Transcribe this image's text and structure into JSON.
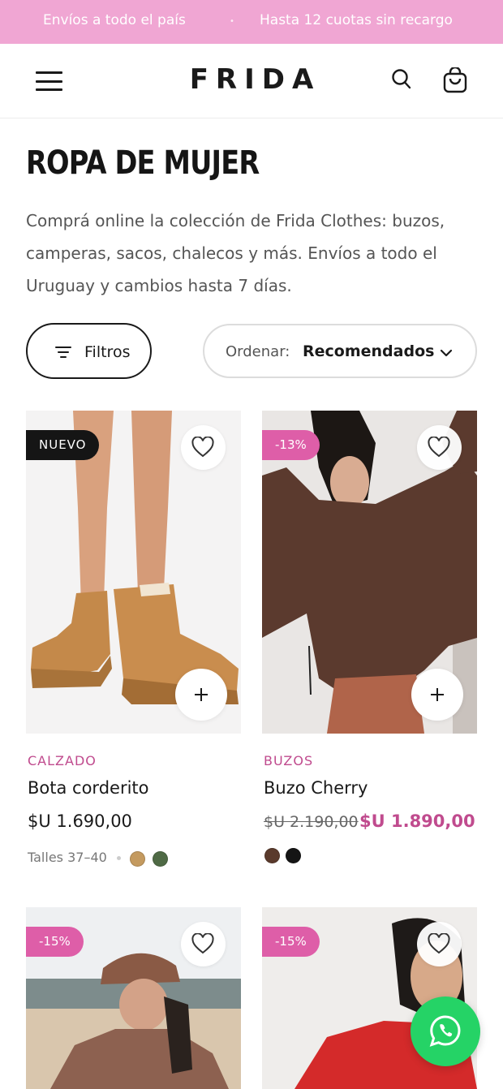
{
  "promo": {
    "left_text": "Envíos a todo el país",
    "right_text": "Hasta 12 cuotas sin recargo",
    "bg_color": "#f0a6d3"
  },
  "header": {
    "logo": "FRIDA",
    "icons": [
      "menu-icon",
      "search-icon",
      "cart-icon"
    ]
  },
  "page": {
    "title": "ROPA DE MUJER",
    "description": "Comprá online la colección de Frida Clothes: buzos, camperas, sacos, chalecos y más. Envíos a todo el Uruguay y cambios hasta 7 días."
  },
  "toolbar": {
    "filters_label": "Filtros",
    "sort_label": "Ordenar:",
    "sort_value": "Recomendados"
  },
  "products": [
    {
      "badge": "NUEVO",
      "category": "CALZADO",
      "name": "Bota corderito",
      "price": "$U 1.690,00",
      "sizes": "Talles 37–40",
      "swatches": [
        "#c49a5f",
        "#4f6a45"
      ]
    },
    {
      "badge": "-13%",
      "category": "BUZOS",
      "name": "Buzo Cherry",
      "price_old": "$U 2.190,00",
      "price": "$U 1.890,00",
      "swatches": [
        "#5a3a2c",
        "#151515"
      ]
    },
    {
      "badge": "-15%"
    },
    {
      "badge": "-15%"
    }
  ],
  "colors": {
    "accent": "#c04b8e",
    "discount_badge": "#de5ea8",
    "new_badge": "#151515",
    "whatsapp": "#25d366"
  }
}
